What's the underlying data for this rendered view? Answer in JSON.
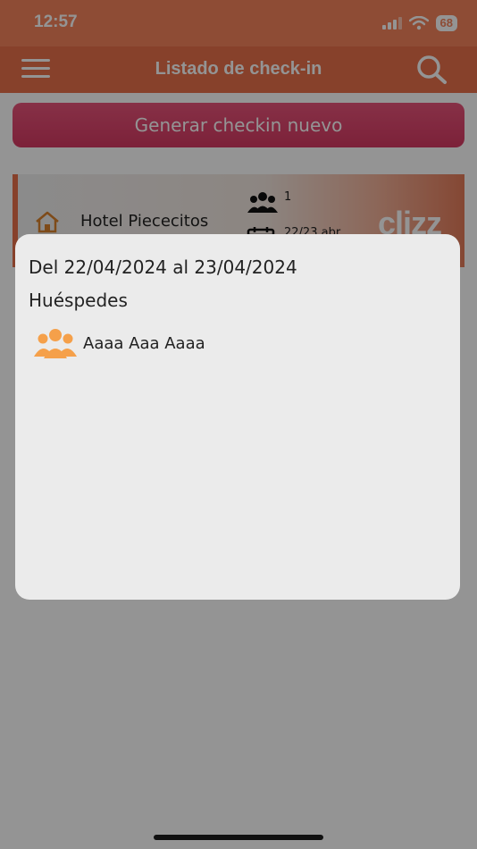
{
  "status_bar": {
    "time": "12:57",
    "battery": "68"
  },
  "app_bar": {
    "title": "Listado de check-in"
  },
  "actions": {
    "new_checkin_label": "Generar checkin nuevo"
  },
  "checkin_card": {
    "hotel_name": "Hotel Piececitos",
    "guest_count": "1",
    "dates_short": "22/23 abr",
    "brand": "clizz",
    "brand_sup": "zz"
  },
  "modal": {
    "date_range": "Del 22/04/2024 al 23/04/2024",
    "guests_heading": "Huéspedes",
    "guests": [
      {
        "name": "Aaaa Aaa Aaaa"
      }
    ]
  },
  "colors": {
    "status_bar": "#f4845c",
    "app_bar": "#e8704a",
    "primary_button": "#d63a63",
    "guest_icon": "#f5a04a"
  }
}
